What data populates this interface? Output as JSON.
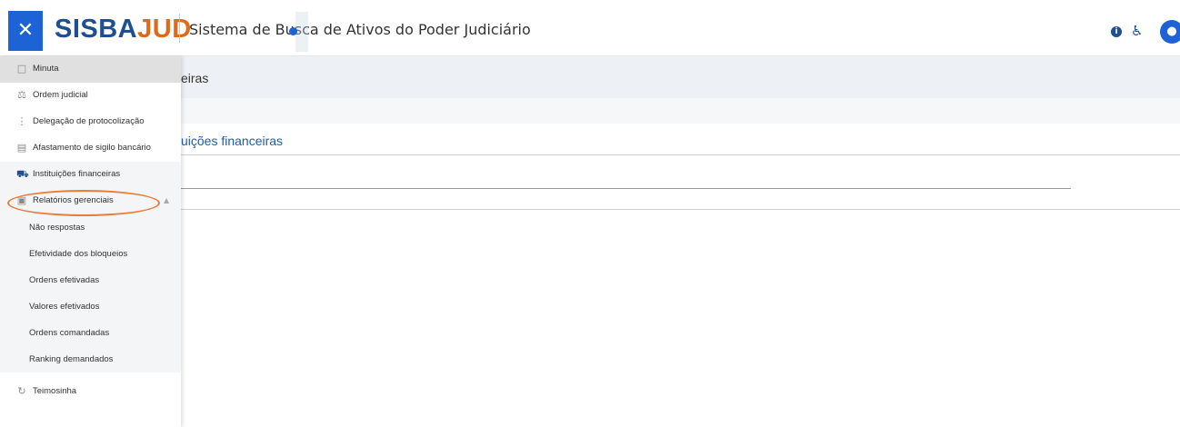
{
  "header": {
    "close_glyph": "✕",
    "logo_part1": "SISBA",
    "logo_part2": "JUD",
    "subtitle": "Sistema de Busca de Ativos do Poder Judiciário",
    "info_glyph": "i",
    "accessibility_glyph": "♿",
    "avatar_glyph": "●"
  },
  "colors": {
    "brand_blue": "#1d4f91",
    "accent_orange": "#e06a17",
    "button_blue": "#1e63d6",
    "link_blue": "#1d5ea8",
    "highlight_orange": "#e87d3a"
  },
  "main": {
    "breadcrumb_partial": "eiras",
    "section_title_partial": "uições financeiras"
  },
  "sidebar": {
    "items": [
      {
        "label": "Minuta",
        "icon": "document-icon"
      },
      {
        "label": "Ordem judicial",
        "icon": "scales-icon"
      },
      {
        "label": "Delegação de protocolização",
        "icon": "delegation-icon"
      },
      {
        "label": "Afastamento de sigilo bancário",
        "icon": "vault-icon"
      },
      {
        "label": "Instituições financeiras",
        "icon": "bank-icon"
      },
      {
        "label": "Relatórios gerenciais",
        "icon": "report-icon"
      }
    ],
    "sub_items": [
      {
        "label": "Não respostas"
      },
      {
        "label": "Efetividade dos bloqueios"
      },
      {
        "label": "Ordens efetivadas"
      },
      {
        "label": "Valores efetivados"
      },
      {
        "label": "Ordens comandadas"
      },
      {
        "label": "Ranking demandados"
      }
    ],
    "last_item": {
      "label": "Teimosinha",
      "icon": "refresh-icon"
    },
    "expanded_chevron": "▲"
  }
}
